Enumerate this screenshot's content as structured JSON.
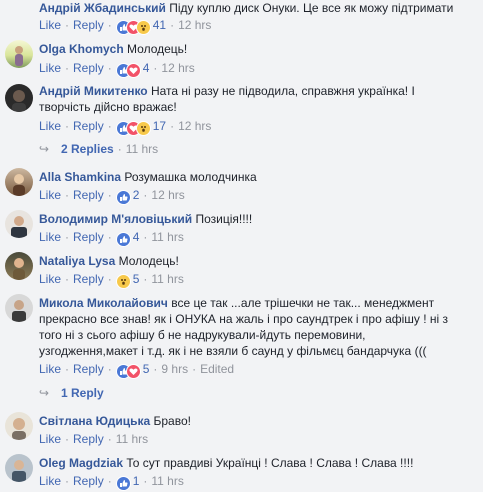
{
  "labels": {
    "like": "Like",
    "reply": "Reply",
    "dot": "·"
  },
  "comments": [
    {
      "name": "Андрій Жбадинський",
      "text": "Піду куплю диск Онуки. Це все як можу підтримати",
      "reactions": [
        "like",
        "love",
        "wow"
      ],
      "count": "41",
      "time": "12 hrs"
    },
    {
      "name": "Olga Khomych",
      "text": "Молодець!",
      "reactions": [
        "like",
        "love"
      ],
      "count": "4",
      "time": "12 hrs"
    },
    {
      "name": "Андрій Микитенко",
      "text_lines": [
        "Ната ні разу не підводила, справжня українка! І",
        "творчість дійсно вражає!"
      ],
      "reactions": [
        "like",
        "love",
        "wow"
      ],
      "count": "17",
      "time": "12 hrs"
    },
    {
      "name": "Alla Shamkina",
      "text": "Розумашка молодчинка",
      "reactions": [
        "like"
      ],
      "count": "2",
      "time": "12 hrs"
    },
    {
      "name": "Володимир М'яловіцький",
      "text": "Позиція!!!!",
      "reactions": [
        "like"
      ],
      "count": "4",
      "time": "11 hrs"
    },
    {
      "name": "Nataliya Lysa",
      "text": "Молодець!",
      "reactions": [
        "wow"
      ],
      "count": "5",
      "time": "11 hrs"
    },
    {
      "name": "Микола Миколайович",
      "text_lines": [
        "все це так ...але трішечки не так... менеджмент",
        "прекрасно все знав! як і ОНУКА на жаль і про саундтрек і про афішу ! ні з",
        "того ні з сього афішу б не надрукували-йдуть перемовини,",
        "узгодження,макет і т.д. як і не взяли б саунд у фільмєц бандарчука ((("
      ],
      "reactions": [
        "like",
        "love"
      ],
      "count": "5",
      "time": "9 hrs",
      "edited": "Edited"
    },
    {
      "name": "Світлана Юдицька",
      "text": "Браво!",
      "reactions": [],
      "count": "",
      "time": "11 hrs"
    },
    {
      "name": "Oleg Magdziak",
      "text": "То сут правдиві Українці ! Слава ! Слава ! Слава !!!!",
      "reactions": [
        "like"
      ],
      "count": "1",
      "time": "11 hrs"
    }
  ],
  "replies_a": {
    "label": "2 Replies",
    "time": "11 hrs"
  },
  "replies_b": {
    "label": "1 Reply"
  },
  "colors": {
    "link": "#365899",
    "meta": "#90949c",
    "background": "#f2f3f5",
    "like": "#4a78d6",
    "love": "#f25268",
    "wow": "#f7c94b"
  }
}
